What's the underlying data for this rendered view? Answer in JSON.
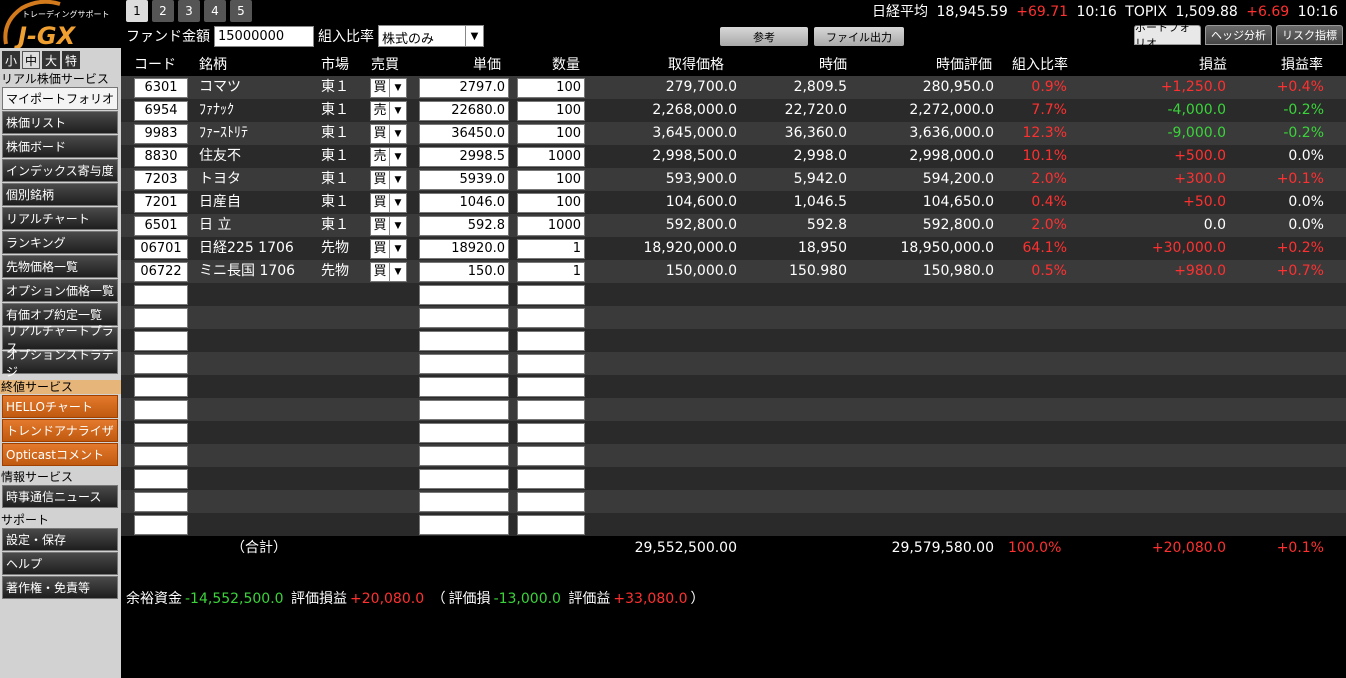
{
  "brand": {
    "tagline": "トレーディングサポート",
    "name": "J-GX"
  },
  "page_tabs": [
    "1",
    "2",
    "3",
    "4",
    "5"
  ],
  "ticker": {
    "nikkei_label": "日経平均",
    "nikkei_value": "18,945.59",
    "nikkei_change": "+69.71",
    "nikkei_time": "10:16",
    "topix_label": "TOPIX",
    "topix_value": "1,509.88",
    "topix_change": "+6.69",
    "topix_time": "10:16"
  },
  "fund": {
    "amount_label": "ファンド金額",
    "amount_value": "15000000",
    "ratio_label": "組入比率",
    "ratio_value": "株式のみ"
  },
  "actions": {
    "reference": "参考",
    "file_output": "ファイル出力"
  },
  "view_tabs": [
    "ポートフォリオ",
    "ヘッジ分析",
    "リスク指標"
  ],
  "sidebar": {
    "sizes": [
      "小",
      "中",
      "大",
      "特"
    ],
    "realtime_header": "リアル株価サービス",
    "realtime_items": [
      "マイポートフォリオ",
      "株価リスト",
      "株価ボード",
      "インデックス寄与度",
      "個別銘柄",
      "リアルチャート",
      "ランキング",
      "先物価格一覧",
      "オプション価格一覧",
      "有価オプ約定一覧",
      "リアルチャートプラス",
      "オプションストラテジ"
    ],
    "close_header": "終値サービス",
    "close_items": [
      "HELLOチャート",
      "トレンドアナライザ",
      "Opticastコメント"
    ],
    "info_header": "情報サービス",
    "info_items": [
      "時事通信ニュース"
    ],
    "support_header": "サポート",
    "support_items": [
      "設定・保存",
      "ヘルプ",
      "著作権・免責等"
    ]
  },
  "table": {
    "headers": {
      "code": "コード",
      "name": "銘柄",
      "market": "市場",
      "side": "売買",
      "unit_price": "単価",
      "qty": "数量",
      "cost": "取得価格",
      "price": "時価",
      "value": "時価評価",
      "weight": "組入比率",
      "pnl": "損益",
      "pnl_rate": "損益率"
    },
    "rows": [
      {
        "code": "6301",
        "name": "コマツ",
        "market": "東１",
        "side": "買",
        "unit_price": "2797.0",
        "qty": "100",
        "cost": "279,700.0",
        "price": "2,809.5",
        "value": "280,950.0",
        "weight": "0.9%",
        "pnl": "+1,250.0",
        "pnl_rate": "+0.4%",
        "pnl_dir": "up",
        "rate_dir": "up"
      },
      {
        "code": "6954",
        "name": "ﾌｧﾅｯｸ",
        "market": "東１",
        "side": "売",
        "unit_price": "22680.0",
        "qty": "100",
        "cost": "2,268,000.0",
        "price": "22,720.0",
        "value": "2,272,000.0",
        "weight": "7.7%",
        "pnl": "-4,000.0",
        "pnl_rate": "-0.2%",
        "pnl_dir": "down",
        "rate_dir": "down"
      },
      {
        "code": "9983",
        "name": "ﾌｧｰｽﾄﾘﾃ",
        "market": "東１",
        "side": "買",
        "unit_price": "36450.0",
        "qty": "100",
        "cost": "3,645,000.0",
        "price": "36,360.0",
        "value": "3,636,000.0",
        "weight": "12.3%",
        "pnl": "-9,000.0",
        "pnl_rate": "-0.2%",
        "pnl_dir": "down",
        "rate_dir": "down"
      },
      {
        "code": "8830",
        "name": "住友不",
        "market": "東１",
        "side": "売",
        "unit_price": "2998.5",
        "qty": "1000",
        "cost": "2,998,500.0",
        "price": "2,998.0",
        "value": "2,998,000.0",
        "weight": "10.1%",
        "pnl": "+500.0",
        "pnl_rate": "0.0%",
        "pnl_dir": "up",
        "rate_dir": "flat"
      },
      {
        "code": "7203",
        "name": "トヨタ",
        "market": "東１",
        "side": "買",
        "unit_price": "5939.0",
        "qty": "100",
        "cost": "593,900.0",
        "price": "5,942.0",
        "value": "594,200.0",
        "weight": "2.0%",
        "pnl": "+300.0",
        "pnl_rate": "+0.1%",
        "pnl_dir": "up",
        "rate_dir": "up"
      },
      {
        "code": "7201",
        "name": "日産自",
        "market": "東１",
        "side": "買",
        "unit_price": "1046.0",
        "qty": "100",
        "cost": "104,600.0",
        "price": "1,046.5",
        "value": "104,650.0",
        "weight": "0.4%",
        "pnl": "+50.0",
        "pnl_rate": "0.0%",
        "pnl_dir": "up",
        "rate_dir": "flat"
      },
      {
        "code": "6501",
        "name": "日 立",
        "market": "東１",
        "side": "買",
        "unit_price": "592.8",
        "qty": "1000",
        "cost": "592,800.0",
        "price": "592.8",
        "value": "592,800.0",
        "weight": "2.0%",
        "pnl": "0.0",
        "pnl_rate": "0.0%",
        "pnl_dir": "flat",
        "rate_dir": "flat"
      },
      {
        "code": "06701",
        "name": "日経225 1706",
        "market": "先物",
        "side": "買",
        "unit_price": "18920.0",
        "qty": "1",
        "cost": "18,920,000.0",
        "price": "18,950",
        "value": "18,950,000.0",
        "weight": "64.1%",
        "pnl": "+30,000.0",
        "pnl_rate": "+0.2%",
        "pnl_dir": "up",
        "rate_dir": "up"
      },
      {
        "code": "06722",
        "name": "ミニ長国 1706",
        "market": "先物",
        "side": "買",
        "unit_price": "150.0",
        "qty": "1",
        "cost": "150,000.0",
        "price": "150.980",
        "value": "150,980.0",
        "weight": "0.5%",
        "pnl": "+980.0",
        "pnl_rate": "+0.7%",
        "pnl_dir": "up",
        "rate_dir": "up"
      }
    ],
    "empty_rows": 11,
    "totals": {
      "label": "（合計）",
      "cost": "29,552,500.00",
      "value": "29,579,580.00",
      "weight": "100.0%",
      "pnl": "+20,080.0",
      "pnl_rate": "+0.1%"
    }
  },
  "summary": {
    "surplus_label": "余裕資金",
    "surplus_value": "-14,552,500.0",
    "eval_pnl_label": "評価損益",
    "eval_pnl_value": "+20,080.0",
    "open_paren": "（",
    "eval_loss_label": "評価損",
    "eval_loss_value": "-13,000.0",
    "eval_gain_label": "評価益",
    "eval_gain_value": "+33,080.0",
    "close_paren": "）"
  },
  "colors": {
    "up": "#ff3030",
    "down": "#3ad43a",
    "accent_orange": "#d86a1e"
  }
}
